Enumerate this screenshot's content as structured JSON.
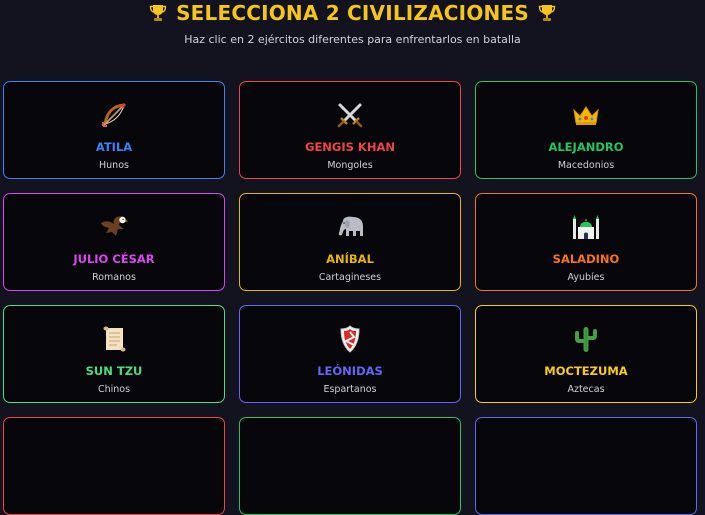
{
  "header": {
    "title": "SELECCIONA 2 CIVILIZACIONES",
    "subtitle": "Haz clic en 2 ejércitos diferentes para enfrentarlos en batalla",
    "title_color": "#f5c518"
  },
  "civilizations": [
    {
      "name": "ATILA",
      "people": "Hunos",
      "color": "#3b82f6",
      "icon": "bow-arrow-icon"
    },
    {
      "name": "GENGIS KHAN",
      "people": "Mongoles",
      "color": "#ef4444",
      "icon": "crossed-swords-icon"
    },
    {
      "name": "ALEJANDRO",
      "people": "Macedonios",
      "color": "#22c55e",
      "icon": "crown-icon"
    },
    {
      "name": "JULIO CÉSAR",
      "people": "Romanos",
      "color": "#d946ef",
      "icon": "eagle-icon"
    },
    {
      "name": "ANÍBAL",
      "people": "Cartagineses",
      "color": "#eab308",
      "icon": "elephant-icon"
    },
    {
      "name": "SALADINO",
      "people": "Ayubíes",
      "color": "#f97316",
      "icon": "mosque-icon"
    },
    {
      "name": "SUN TZU",
      "people": "Chinos",
      "color": "#4ade80",
      "icon": "scroll-icon"
    },
    {
      "name": "LEÓNIDAS",
      "people": "Espartanos",
      "color": "#6366f1",
      "icon": "shield-icon"
    },
    {
      "name": "MOCTEZUMA",
      "people": "Aztecas",
      "color": "#facc15",
      "icon": "cactus-icon"
    }
  ],
  "partial_row_colors": [
    "#ef4444",
    "#22c55e",
    "#6366f1"
  ]
}
